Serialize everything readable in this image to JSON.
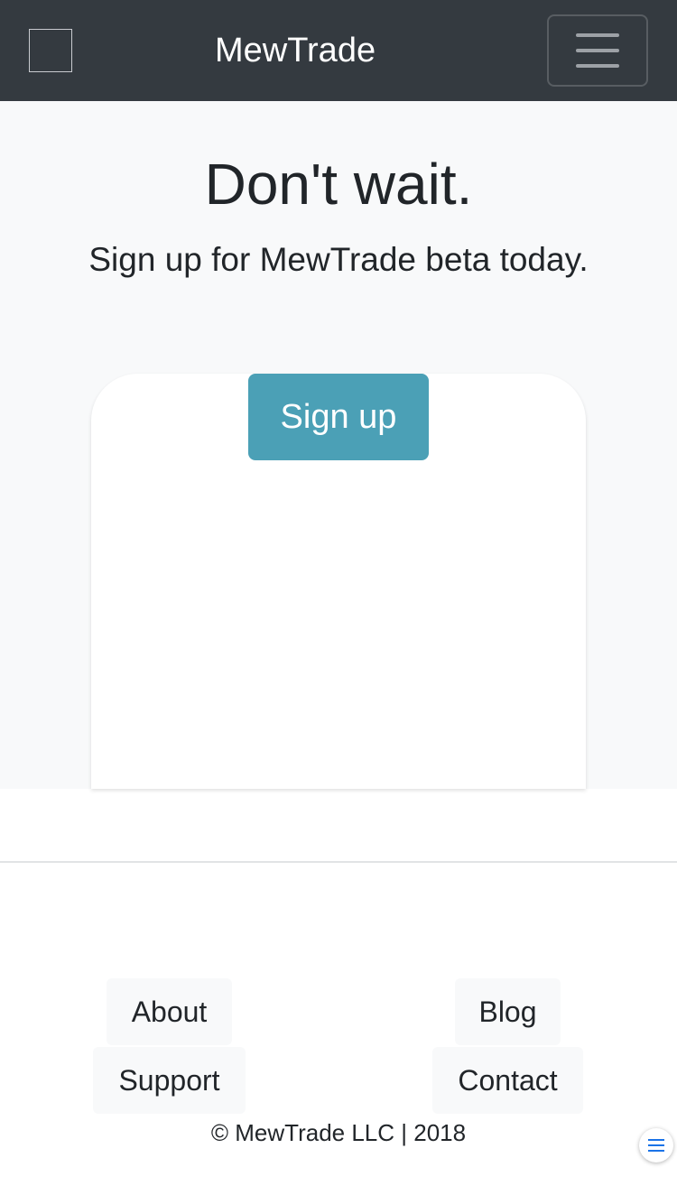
{
  "navbar": {
    "brand": "MewTrade",
    "menu_icon": "hamburger-icon",
    "logo_icon": "logo-placeholder-icon"
  },
  "hero": {
    "title": "Don't wait.",
    "subtitle": "Sign up for MewTrade beta today.",
    "signup_label": "Sign up"
  },
  "footer": {
    "links": [
      "About",
      "Blog",
      "Support",
      "Contact"
    ],
    "copyright": "© MewTrade LLC | 2018",
    "fab_icon": "list-menu-icon"
  },
  "colors": {
    "navbar_bg": "#343a40",
    "hero_bg": "#f8f9fa",
    "signup_button": "#4ba0b6",
    "fab_accent": "#1a73e8"
  }
}
